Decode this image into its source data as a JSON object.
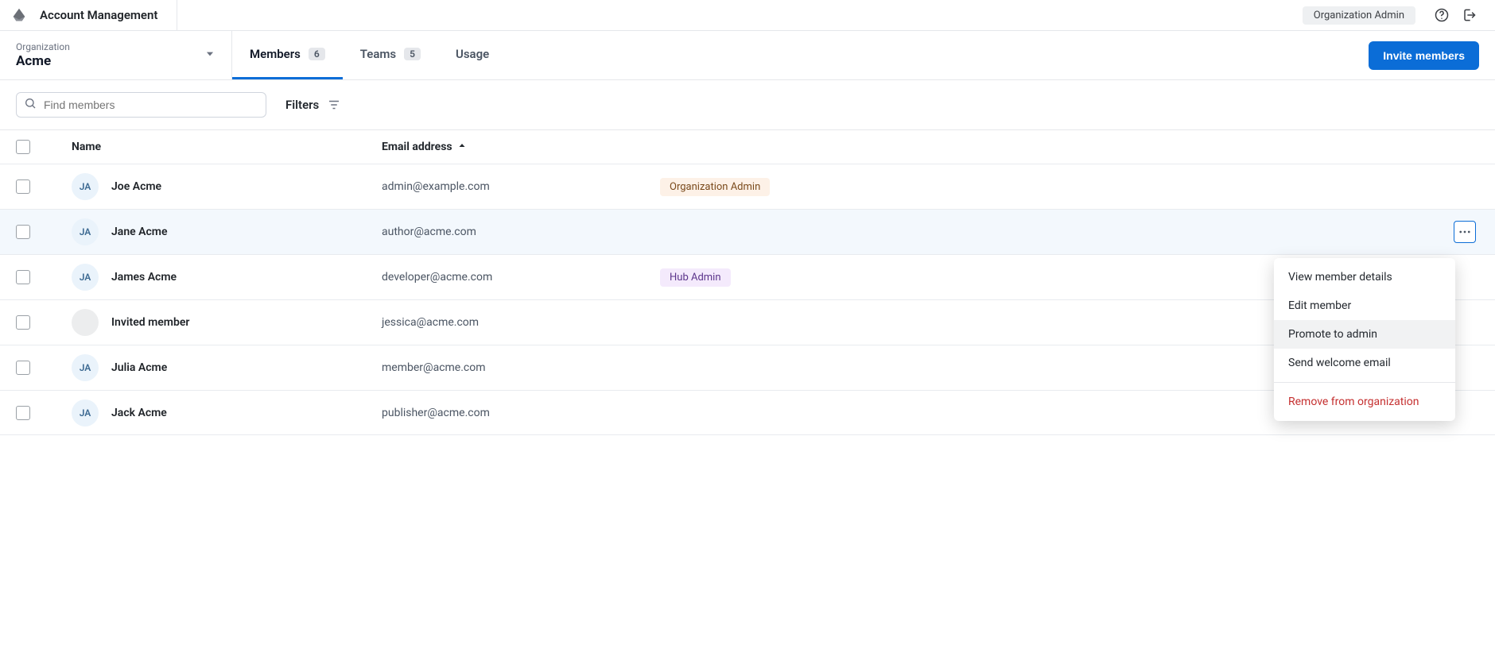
{
  "header": {
    "app_title": "Account Management",
    "role_pill": "Organization Admin"
  },
  "org_selector": {
    "label": "Organization",
    "name": "Acme"
  },
  "tabs": {
    "members": {
      "label": "Members",
      "count": "6"
    },
    "teams": {
      "label": "Teams",
      "count": "5"
    },
    "usage": {
      "label": "Usage"
    }
  },
  "actions": {
    "invite_label": "Invite members"
  },
  "filterbar": {
    "search_placeholder": "Find members",
    "search_value": "",
    "filters_label": "Filters"
  },
  "table": {
    "columns": {
      "name": "Name",
      "email": "Email address"
    },
    "rows": [
      {
        "initials": "JA",
        "name": "Joe Acme",
        "email": "admin@example.com",
        "role": "Organization Admin",
        "role_class": "role-org-admin",
        "blank_avatar": false
      },
      {
        "initials": "JA",
        "name": "Jane Acme",
        "email": "author@acme.com",
        "role": "",
        "role_class": "",
        "blank_avatar": false
      },
      {
        "initials": "JA",
        "name": "James Acme",
        "email": "developer@acme.com",
        "role": "Hub Admin",
        "role_class": "role-hub-admin",
        "blank_avatar": false
      },
      {
        "initials": "",
        "name": "Invited member",
        "email": "jessica@acme.com",
        "role": "",
        "role_class": "",
        "blank_avatar": true
      },
      {
        "initials": "JA",
        "name": "Julia Acme",
        "email": "member@acme.com",
        "role": "",
        "role_class": "",
        "blank_avatar": false
      },
      {
        "initials": "JA",
        "name": "Jack Acme",
        "email": "publisher@acme.com",
        "role": "",
        "role_class": "",
        "blank_avatar": false
      }
    ]
  },
  "context_menu": {
    "view": "View member details",
    "edit": "Edit member",
    "promote": "Promote to admin",
    "welcome": "Send welcome email",
    "remove": "Remove from organization"
  }
}
